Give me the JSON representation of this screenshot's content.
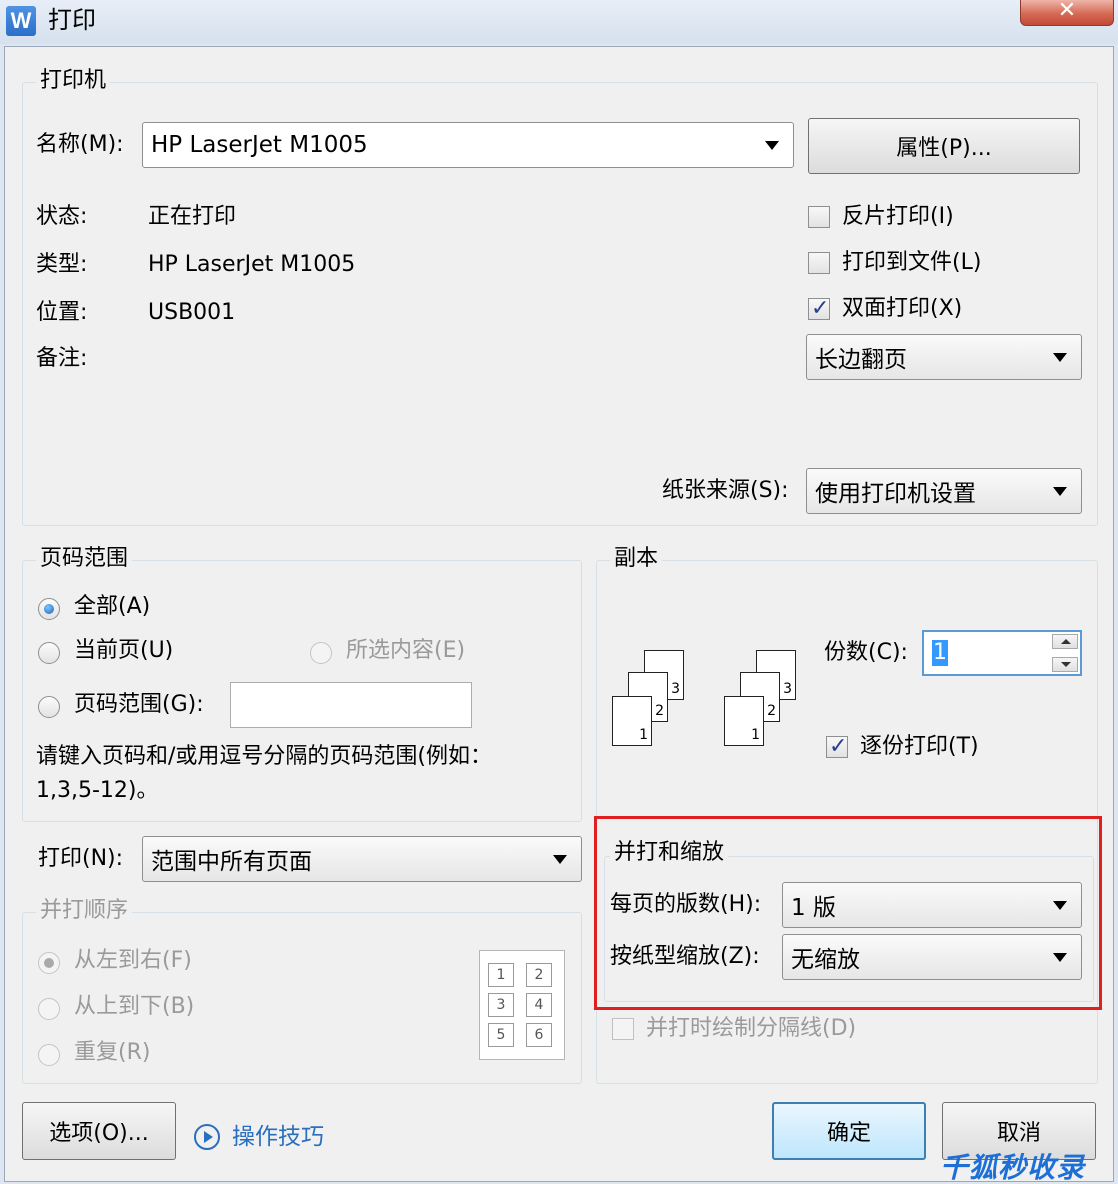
{
  "window": {
    "icon_letter": "W",
    "title": "打印",
    "close_symbol": "✕"
  },
  "printer": {
    "group_title": "打印机",
    "name_label": "名称(M):",
    "name_value": "HP LaserJet M1005",
    "properties_button": "属性(P)...",
    "status_label": "状态:",
    "status_value": "正在打印",
    "type_label": "类型:",
    "type_value": "HP LaserJet M1005",
    "location_label": "位置:",
    "location_value": "USB001",
    "comment_label": "备注:",
    "reverse_print": {
      "label": "反片打印(I)",
      "checked": false
    },
    "print_to_file": {
      "label": "打印到文件(L)",
      "checked": false
    },
    "duplex": {
      "label": "双面打印(X)",
      "checked": true
    },
    "duplex_mode": "长边翻页",
    "paper_source_label": "纸张来源(S):",
    "paper_source_value": "使用打印机设置"
  },
  "page_range": {
    "group_title": "页码范围",
    "all": "全部(A)",
    "current_page": "当前页(U)",
    "selection": "所选内容(E)",
    "pages": "页码范围(G):",
    "pages_value": "",
    "hint": "请键入页码和/或用逗号分隔的页码范围(例如：",
    "hint_example": "1,3,5-12)。",
    "selected": "all"
  },
  "print_what": {
    "label": "打印(N):",
    "value": "范围中所有页面"
  },
  "collate_order": {
    "group_title": "并打顺序",
    "left_to_right": "从左到右(F)",
    "top_to_bottom": "从上到下(B)",
    "repeat": "重复(R)",
    "grid_cells": [
      "1",
      "2",
      "3",
      "4",
      "5",
      "6"
    ]
  },
  "copies": {
    "group_title": "副本",
    "count_label": "份数(C):",
    "count_value": "1",
    "collate": {
      "label": "逐份打印(T)",
      "checked": true
    },
    "page_stack_labels": [
      "3",
      "2",
      "1"
    ]
  },
  "zoom": {
    "group_title": "并打和缩放",
    "pages_per_sheet_label": "每页的版数(H):",
    "pages_per_sheet_value": "1 版",
    "scale_label": "按纸型缩放(Z):",
    "scale_value": "无缩放",
    "draw_borders": {
      "label": "并打时绘制分隔线(D)",
      "checked": false
    }
  },
  "footer": {
    "options_button": "选项(O)...",
    "tips_link": "操作技巧",
    "ok_button": "确定",
    "cancel_button": "取消"
  },
  "watermark": "千狐秒收录",
  "colors": {
    "highlight_border": "#e02020",
    "link": "#2a6fbd",
    "default_button_border": "#3c7fb1"
  }
}
